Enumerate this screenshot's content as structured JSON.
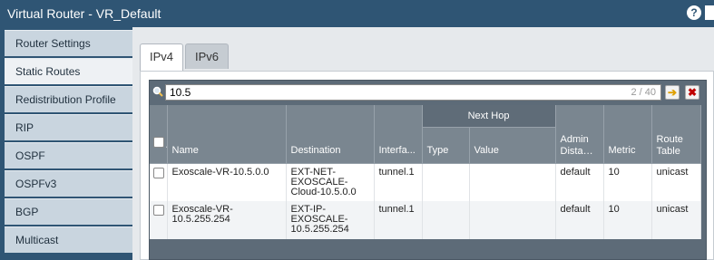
{
  "window": {
    "title": "Virtual Router - VR_Default"
  },
  "sidebar": {
    "items": [
      {
        "label": "Router Settings"
      },
      {
        "label": "Static Routes"
      },
      {
        "label": "Redistribution Profile"
      },
      {
        "label": "RIP"
      },
      {
        "label": "OSPF"
      },
      {
        "label": "OSPFv3"
      },
      {
        "label": "BGP"
      },
      {
        "label": "Multicast"
      }
    ],
    "active_index": 1
  },
  "tabs": [
    {
      "label": "IPv4",
      "active": true
    },
    {
      "label": "IPv6",
      "active": false
    }
  ],
  "search": {
    "value": "10.5",
    "count": "2 / 40"
  },
  "table": {
    "group_header": "Next Hop",
    "columns": {
      "name": "Name",
      "destination": "Destination",
      "interface": "Interfa...",
      "type": "Type",
      "value": "Value",
      "admin_distance": "Admin Distance",
      "metric": "Metric",
      "route_table": "Route Table"
    },
    "rows": [
      {
        "name": "Exoscale-VR-10.5.0.0",
        "destination": "EXT-NET-EXOSCALE-Cloud-10.5.0.0",
        "interface": "tunnel.1",
        "type": "",
        "value": "",
        "admin_distance": "default",
        "metric": "10",
        "route_table": "unicast"
      },
      {
        "name": "Exoscale-VR-10.5.255.254",
        "destination": "EXT-IP-EXOSCALE-10.5.255.254",
        "interface": "tunnel.1",
        "type": "",
        "value": "",
        "admin_distance": "default",
        "metric": "10",
        "route_table": "unicast"
      }
    ]
  },
  "icons": {
    "help": "help-icon",
    "search": "search-icon",
    "go": "arrow-right-icon",
    "clear": "close-icon"
  },
  "colors": {
    "titlebar": "#2f5574",
    "header": "#7a8690",
    "group_header": "#5f6c78"
  }
}
